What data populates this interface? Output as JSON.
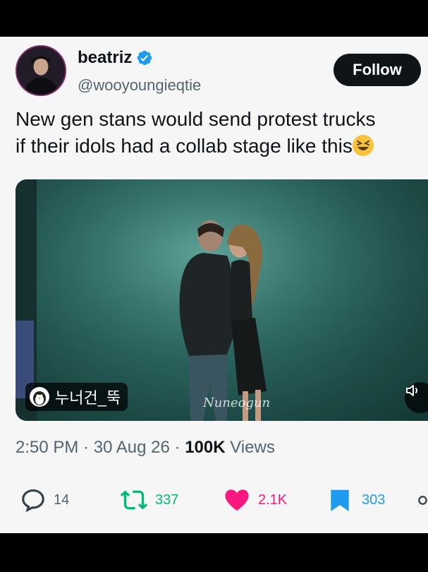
{
  "tweet": {
    "author": {
      "display_name": "beatriz",
      "handle": "@wooyoungieqtie",
      "verified": true
    },
    "follow_label": "Follow",
    "text_line1": "New gen stans would send protest trucks",
    "text_line2": "if their idols had a collab stage like this",
    "emoji": "grinning-squinting-face",
    "media": {
      "sticker_label": "누너건_뚝",
      "watermark": "Nuneogun",
      "type": "video"
    },
    "meta": {
      "time": "2:50 PM",
      "date": "30 Aug 26",
      "views_count": "100K",
      "views_label": "Views",
      "sep": "·"
    },
    "actions": {
      "replies": "14",
      "reposts": "337",
      "likes": "2.1K",
      "bookmarks": "303"
    }
  },
  "colors": {
    "verified_blue": "#1d9bf0",
    "repost_green": "#00ba7c",
    "like_pink": "#f91880",
    "bookmark_blue": "#1d9bf0",
    "text_dark": "#0f1419",
    "text_gray": "#536471"
  }
}
